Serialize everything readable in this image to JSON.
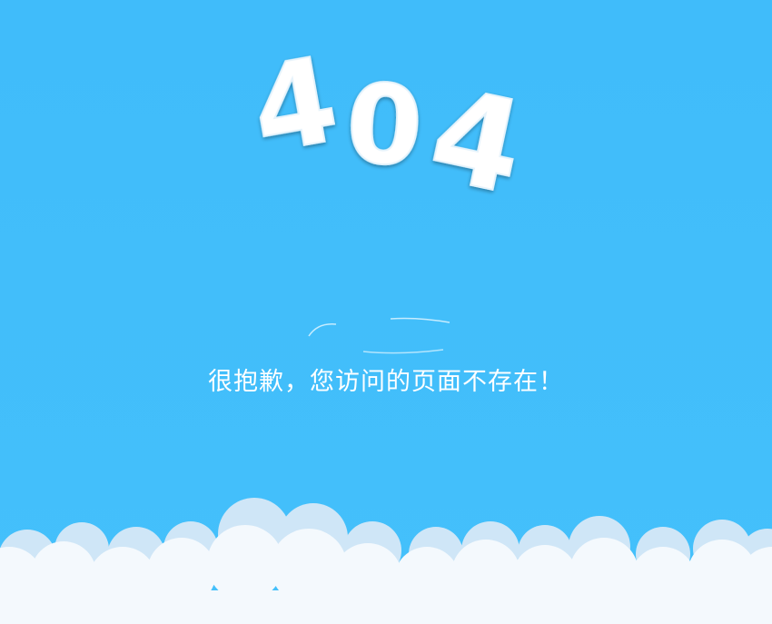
{
  "error": {
    "code_digits": [
      "4",
      "0",
      "4"
    ],
    "message": "很抱歉，您访问的页面不存在！"
  },
  "colors": {
    "sky": "#41bdfb",
    "text": "#ffffff",
    "cloud": "#f4f9fd",
    "cloud_shadow": "#cfe6f7"
  }
}
